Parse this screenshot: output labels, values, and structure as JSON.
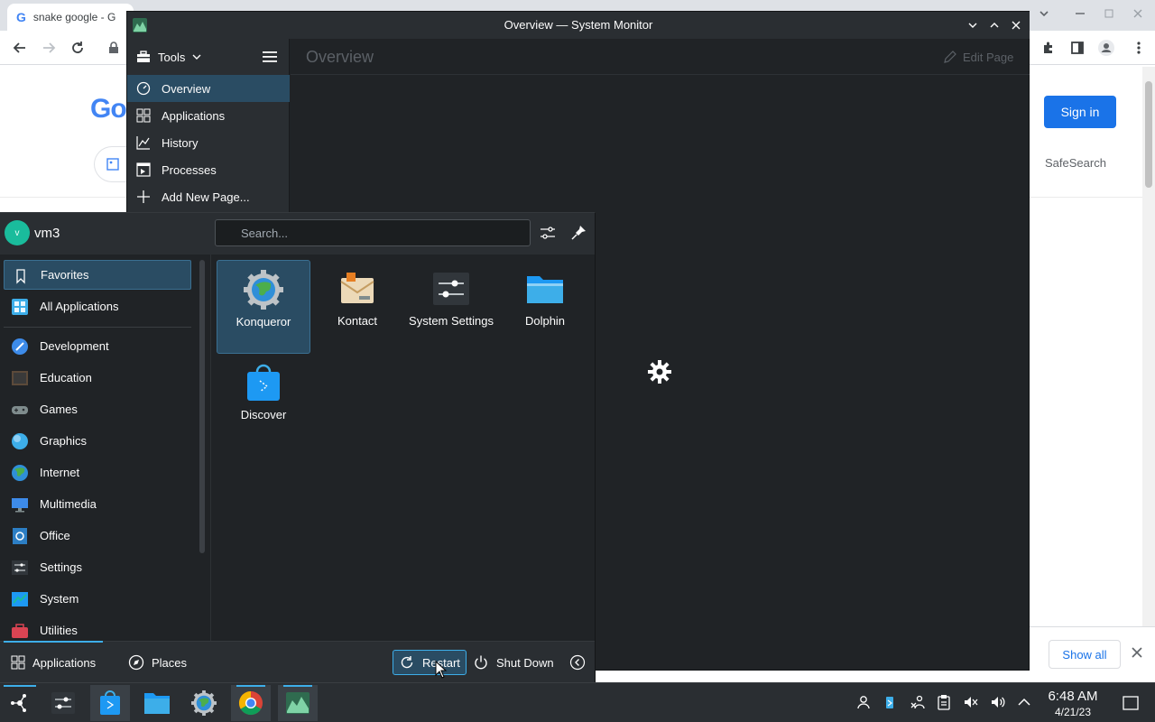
{
  "chrome": {
    "tab_title": "snake google - G",
    "tab_favicon": "G",
    "google_logo_peek": "Go",
    "signin": "Sign in",
    "safesearch": "SafeSearch",
    "show_all": "Show all"
  },
  "system_monitor": {
    "window_title": "Overview — System Monitor",
    "tools_label": "Tools",
    "nav": [
      {
        "label": "Overview",
        "icon": "speedometer-icon"
      },
      {
        "label": "Applications",
        "icon": "grid-icon"
      },
      {
        "label": "History",
        "icon": "chart-icon"
      },
      {
        "label": "Processes",
        "icon": "process-icon"
      },
      {
        "label": "Add New Page...",
        "icon": "plus-icon"
      }
    ],
    "page_title": "Overview",
    "edit_page": "Edit Page"
  },
  "kickoff": {
    "avatar_initial": "v",
    "username": "vm3",
    "search_placeholder": "Search...",
    "categories": [
      {
        "label": "Favorites",
        "icon": "bookmark-icon",
        "selected": true
      },
      {
        "label": "All Applications",
        "icon": "all-apps-icon"
      },
      {
        "label": "Development",
        "icon": "development-icon"
      },
      {
        "label": "Education",
        "icon": "education-icon"
      },
      {
        "label": "Games",
        "icon": "games-icon"
      },
      {
        "label": "Graphics",
        "icon": "graphics-icon"
      },
      {
        "label": "Internet",
        "icon": "internet-icon"
      },
      {
        "label": "Multimedia",
        "icon": "multimedia-icon"
      },
      {
        "label": "Office",
        "icon": "office-icon"
      },
      {
        "label": "Settings",
        "icon": "settings-icon"
      },
      {
        "label": "System",
        "icon": "system-icon"
      },
      {
        "label": "Utilities",
        "icon": "utilities-icon"
      }
    ],
    "favorites": [
      {
        "label": "Konqueror",
        "icon": "konqueror-icon",
        "selected": true
      },
      {
        "label": "Kontact",
        "icon": "kontact-icon"
      },
      {
        "label": "System Settings",
        "icon": "system-settings-icon"
      },
      {
        "label": "Dolphin",
        "icon": "dolphin-folder-icon"
      },
      {
        "label": "Discover",
        "icon": "discover-icon"
      }
    ],
    "footer": {
      "applications": "Applications",
      "places": "Places",
      "restart": "Restart",
      "shutdown": "Shut Down"
    }
  },
  "taskbar": {
    "time": "6:48 AM",
    "date": "4/21/23"
  },
  "colors": {
    "accent": "#3daee9",
    "selection": "#2a4c63",
    "panel": "#2a2e32",
    "window_bg": "#202326",
    "chrome_signin": "#1a73e8"
  }
}
